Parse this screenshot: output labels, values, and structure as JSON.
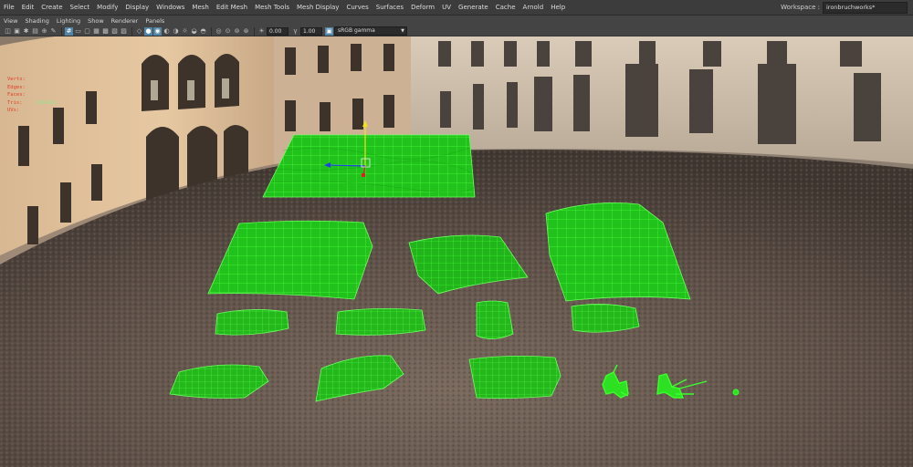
{
  "menubar": {
    "items": [
      "File",
      "Edit",
      "Create",
      "Select",
      "Modify",
      "Display",
      "Windows",
      "Mesh",
      "Edit Mesh",
      "Mesh Tools",
      "Mesh Display",
      "Curves",
      "Surfaces",
      "Deform",
      "UV",
      "Generate",
      "Cache",
      "Arnold",
      "Help"
    ],
    "workspace_label": "Workspace :",
    "workspace_value": "ironbruchworks*"
  },
  "panelbar": {
    "items": [
      "View",
      "Shading",
      "Lighting",
      "Show",
      "Renderer",
      "Panels"
    ]
  },
  "toolbar": {
    "exposure": "0.00",
    "gamma": "1.00",
    "colorspace": "sRGB gamma"
  },
  "hud": {
    "rows": [
      {
        "label": "Verts:",
        "a": "",
        "b": "",
        "c": ""
      },
      {
        "label": "Edges:",
        "a": "",
        "b": "",
        "c": ""
      },
      {
        "label": "Faces:",
        "a": "",
        "b": "",
        "c": ""
      },
      {
        "label": "Tris:",
        "a": "1014122",
        "b": "",
        "c": ""
      },
      {
        "label": "UVs:",
        "a": "",
        "b": "",
        "c": ""
      }
    ]
  },
  "colors": {
    "wire": "#39ff2a",
    "fill": "#1ed01a",
    "menu_bg": "#3c3c3c",
    "accent": "#5285a6"
  }
}
